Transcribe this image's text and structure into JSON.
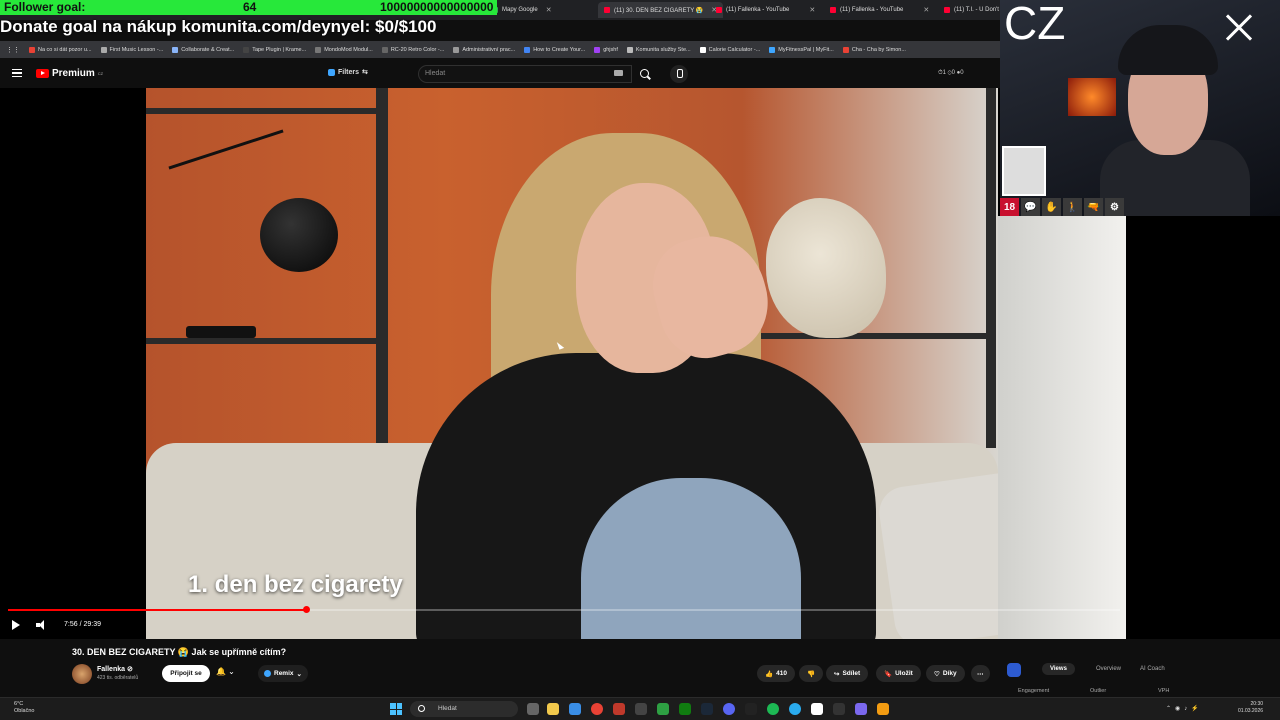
{
  "browser": {
    "tabs": [
      {
        "label": "Mapy Google"
      },
      {
        "label": "(11) 30. DEN BEZ CIGARETY 😭",
        "active": true
      },
      {
        "label": "(11) Fallenka - YouTube"
      },
      {
        "label": "(11) Fallenka - YouTube"
      },
      {
        "label": "(11) T.I. - U Don't"
      }
    ],
    "bookmarks": [
      "Na co si dát pozor u...",
      "First Music Lesson -...",
      "Collaborate & Creat...",
      "Tape Plugin | Kramе...",
      "MondoMod Modul...",
      "RC-20 Retro Color -...",
      "Administrativní prac...",
      "How to Create Your...",
      "ghjshf",
      "Komunita služby Ste...",
      "Calorie Calculator -...",
      "MyFitnessPal | MyFit...",
      "Cha - Cha by Simon..."
    ]
  },
  "overlay": {
    "goal_label": "Follower goal:",
    "goal_current": "64",
    "goal_target": "10000000000000000",
    "goal_progress": 0.0,
    "donate_text": "Donate goal na nákup komunita.com/deynyel: $0/$100",
    "cam_label": "CZ",
    "cam_icons": [
      "18",
      "💬",
      "✋",
      "🚶",
      "🔫",
      "⚙"
    ]
  },
  "youtube": {
    "logo_text": "Premium",
    "logo_region": "CZ",
    "filters_label": "Filters",
    "search_placeholder": "Hledat",
    "header_stats": "⏱1 ⊙0 ●0",
    "caption": "1. den bez cigarety",
    "time": "7:56 / 29:39",
    "progress": 0.268,
    "video_title": "30. DEN BEZ CIGARETY 😭 Jak se upřímně cítím?",
    "channel_name": "Fallenka ⊘",
    "subscribers": "423 tis. odběratelů",
    "join_label": "Připojit se",
    "bell_label": "🔔 ⌄",
    "remix_label": "Remix",
    "likes": "410",
    "share_label": "Sdílet",
    "save_label": "Uložit",
    "thanks_label": "Díky",
    "more_label": "⋯",
    "analytics_tabs": [
      "Views",
      "Overview",
      "AI Coach"
    ],
    "analytics_cols": [
      "Engagement",
      "Outlier",
      "VPH"
    ]
  },
  "taskbar": {
    "weather_temp": "6°C",
    "weather_desc": "Oblačno",
    "search_label": "Hledat",
    "time": "20:30",
    "date": "01.03.2026"
  },
  "colors": {
    "goal_green": "#27e83a",
    "yt_red": "#ff0000",
    "accent_blue": "#3ea6ff"
  }
}
